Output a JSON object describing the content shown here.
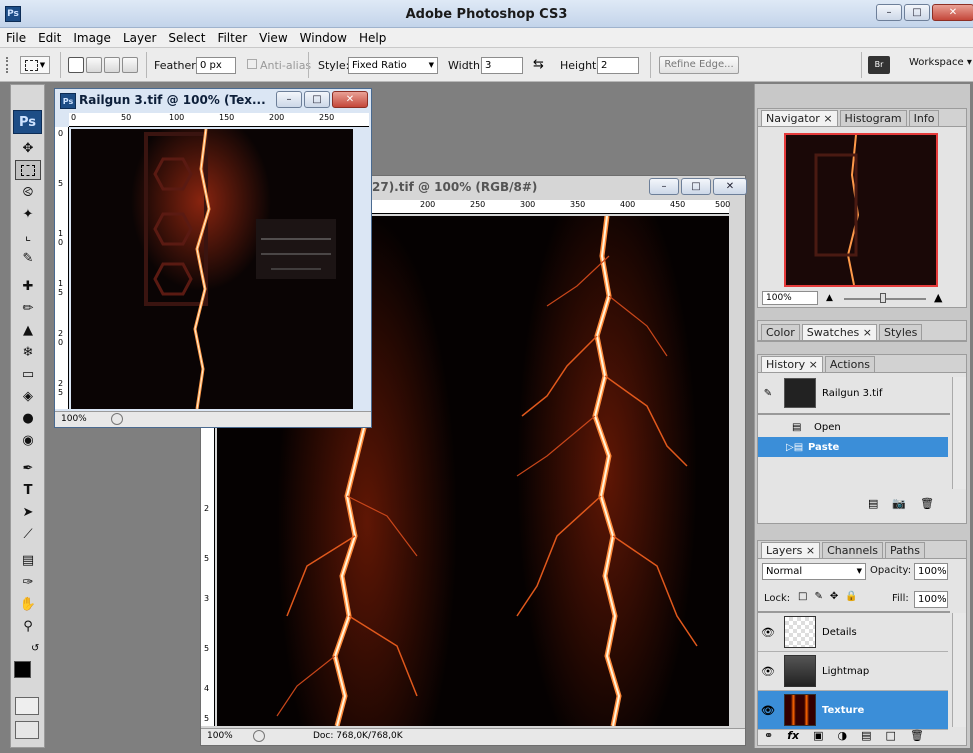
{
  "app": {
    "title": "Adobe Photoshop CS3",
    "logo": "Ps"
  },
  "menu": [
    "File",
    "Edit",
    "Image",
    "Layer",
    "Select",
    "Filter",
    "View",
    "Window",
    "Help"
  ],
  "options": {
    "feather_label": "Feather:",
    "feather_value": "0 px",
    "antialias_label": "Anti-alias",
    "style_label": "Style:",
    "style_value": "Fixed Ratio",
    "width_label": "Width:",
    "width_value": "3",
    "height_label": "Height:",
    "height_value": "2",
    "refine_label": "Refine Edge...",
    "workspace_label": "Workspace"
  },
  "toolbox": {
    "logo": "Ps"
  },
  "doc_front": {
    "title": "Railgun 3.tif @ 100% (Tex...",
    "ruler_h": [
      "0",
      "50",
      "100",
      "150",
      "200",
      "250"
    ],
    "ruler_v": [
      "0",
      "5",
      "1 0",
      "1 5",
      "2 0",
      "2 5"
    ],
    "zoom": "100%"
  },
  "doc_back": {
    "title": "27).tif @ 100% (RGB/8#)",
    "ruler_h": [
      "200",
      "250",
      "300",
      "350",
      "400",
      "450",
      "500"
    ],
    "ruler_v": [
      "2",
      "5",
      "3",
      "5",
      "4",
      "5"
    ],
    "zoom": "100%",
    "doc_size": "Doc: 768,0K/768,0K"
  },
  "navigator": {
    "tabs": [
      "Navigator",
      "Histogram",
      "Info"
    ],
    "zoom": "100%"
  },
  "color_panel": {
    "tabs": [
      "Color",
      "Swatches",
      "Styles"
    ]
  },
  "history": {
    "tabs": [
      "History",
      "Actions"
    ],
    "snapshot": "Railgun 3.tif",
    "states": [
      "Open",
      "Paste"
    ],
    "active_state": "Paste"
  },
  "layers": {
    "tabs": [
      "Layers",
      "Channels",
      "Paths"
    ],
    "blend_mode": "Normal",
    "opacity_label": "Opacity:",
    "opacity_value": "100%",
    "lock_label": "Lock:",
    "fill_label": "Fill:",
    "fill_value": "100%",
    "items": [
      "Details",
      "Lightmap",
      "Texture"
    ],
    "active": "Texture"
  },
  "colors": {
    "selection": "#3b8ed8",
    "accent": "#1d4d86"
  }
}
